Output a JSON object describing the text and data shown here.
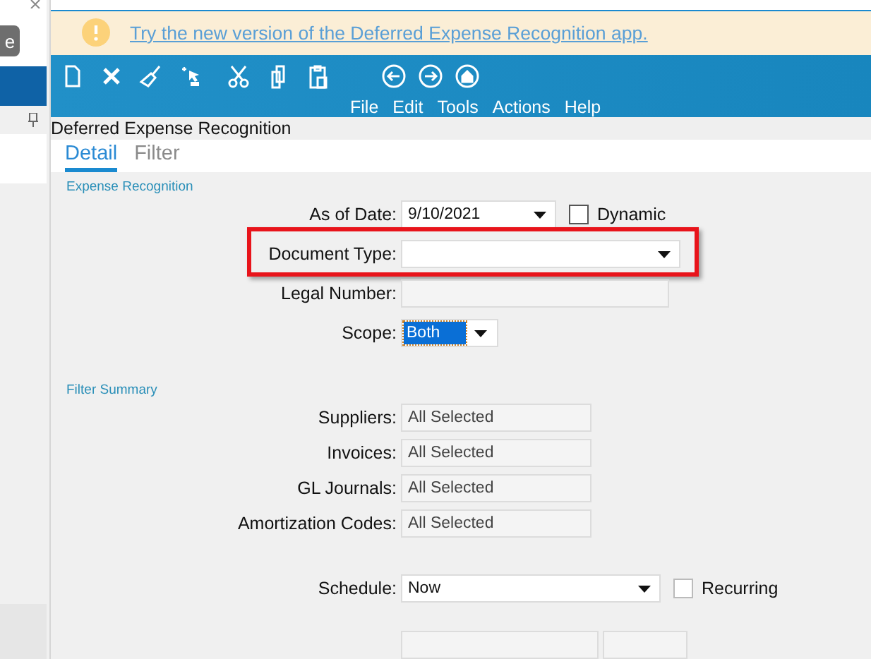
{
  "background_panel": {
    "button_label": "e"
  },
  "banner": {
    "link": "Try the new version of the Deferred Expense Recognition app."
  },
  "menu": [
    "File",
    "Edit",
    "Tools",
    "Actions",
    "Help"
  ],
  "page_title": "Deferred Expense Recognition",
  "tabs": [
    {
      "label": "Detail",
      "selected": true
    },
    {
      "label": "Filter",
      "selected": false
    }
  ],
  "sections": [
    {
      "title": "Expense Recognition",
      "fields": [
        {
          "kind": "dropdown",
          "label": "As of Date:",
          "value": "9/10/2021",
          "checkbox": {
            "label": "Dynamic",
            "checked": false
          }
        },
        {
          "kind": "dropdown",
          "label": "Document Type:",
          "highlighted": true
        },
        {
          "kind": "readonly",
          "label": "Legal Number:"
        },
        {
          "kind": "combo",
          "label": "Scope:",
          "value": "Both"
        }
      ]
    },
    {
      "title": "Filter Summary",
      "fields": [
        {
          "kind": "readonly",
          "label": "Suppliers:",
          "value": "All Selected"
        },
        {
          "kind": "readonly",
          "label": "Invoices:",
          "value": "All Selected"
        },
        {
          "kind": "readonly",
          "label": "GL Journals:",
          "value": "All Selected"
        },
        {
          "kind": "readonly",
          "label": "Amortization Codes:",
          "value": "All Selected"
        }
      ]
    }
  ],
  "schedule": {
    "label": "Schedule:",
    "value": "Now",
    "checkbox": {
      "label": "Recurring",
      "checked": false
    }
  }
}
